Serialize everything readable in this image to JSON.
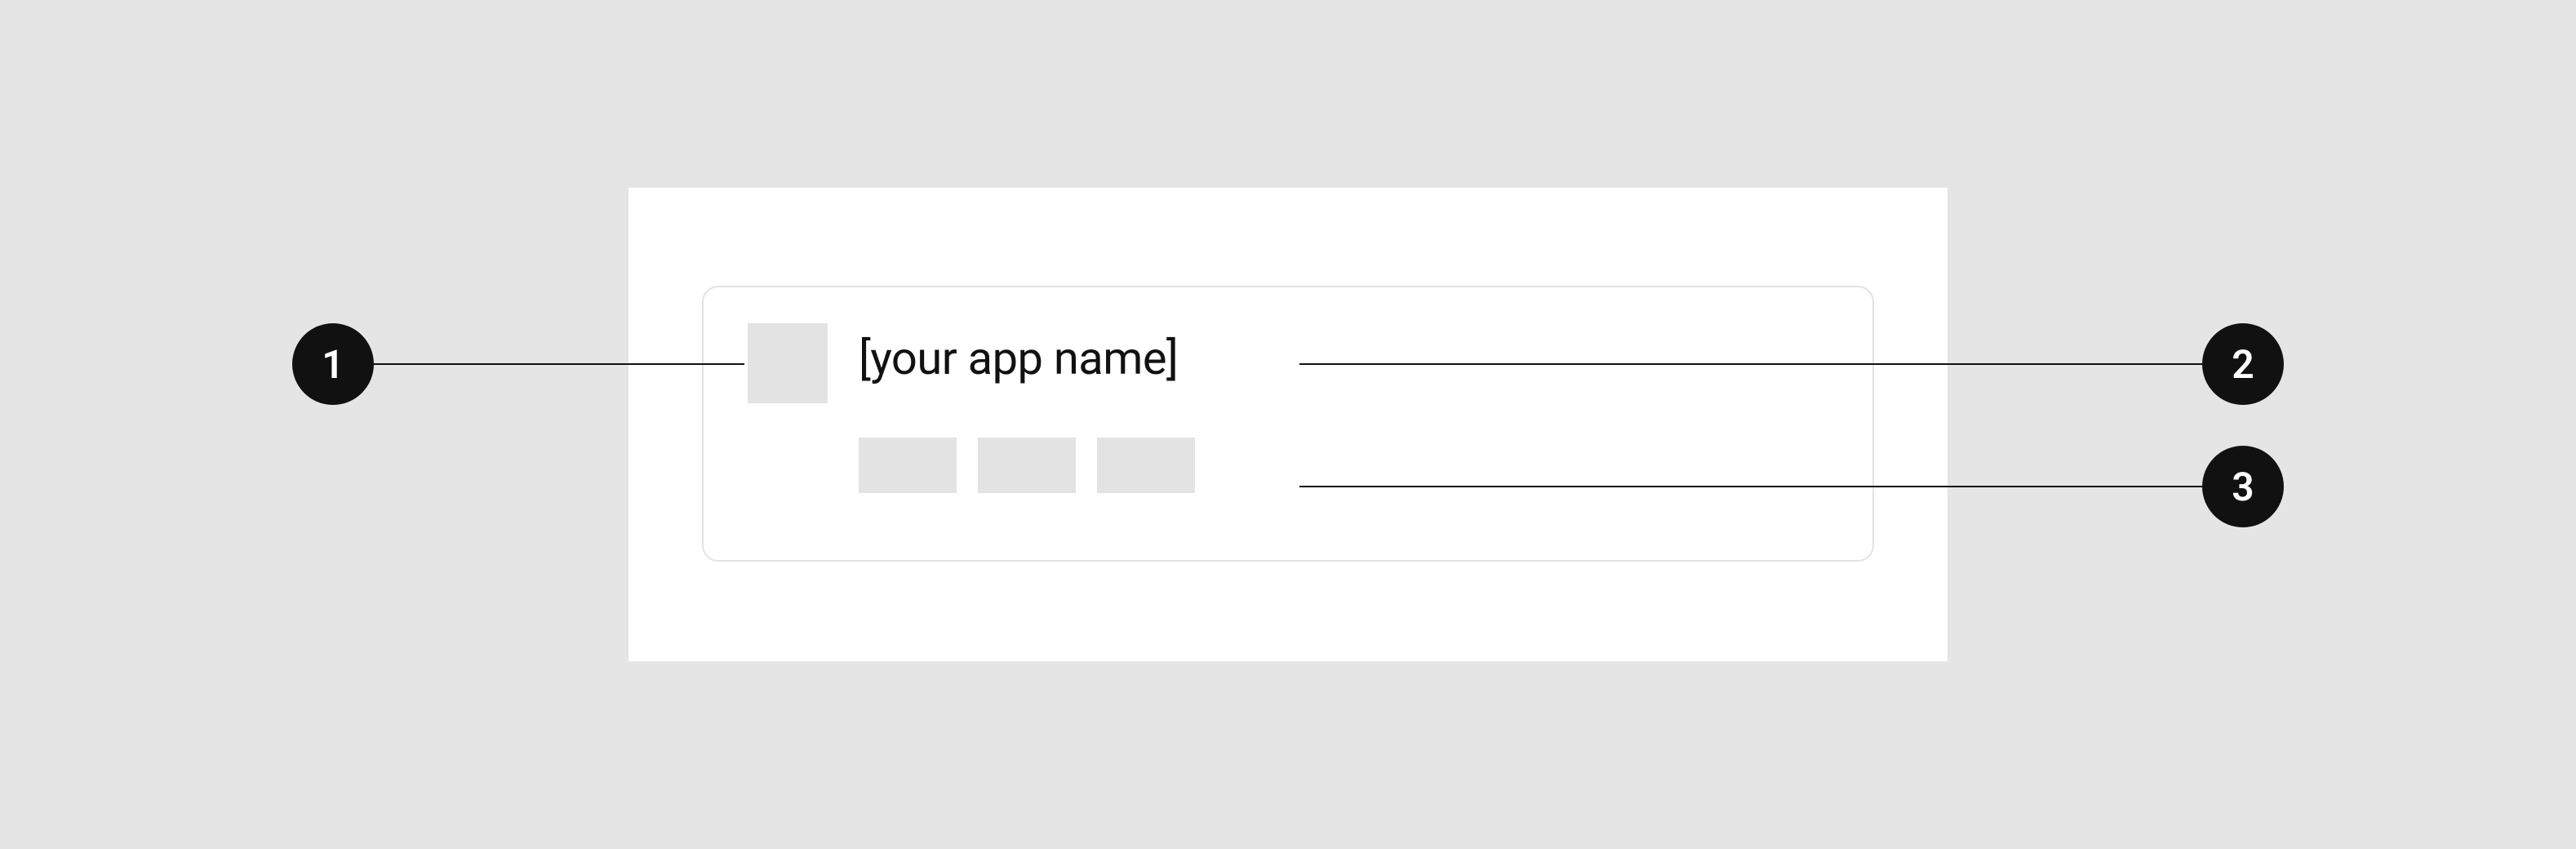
{
  "callouts": {
    "one": "1",
    "two": "2",
    "three": "3"
  },
  "card": {
    "app_name": "[your app name]"
  }
}
